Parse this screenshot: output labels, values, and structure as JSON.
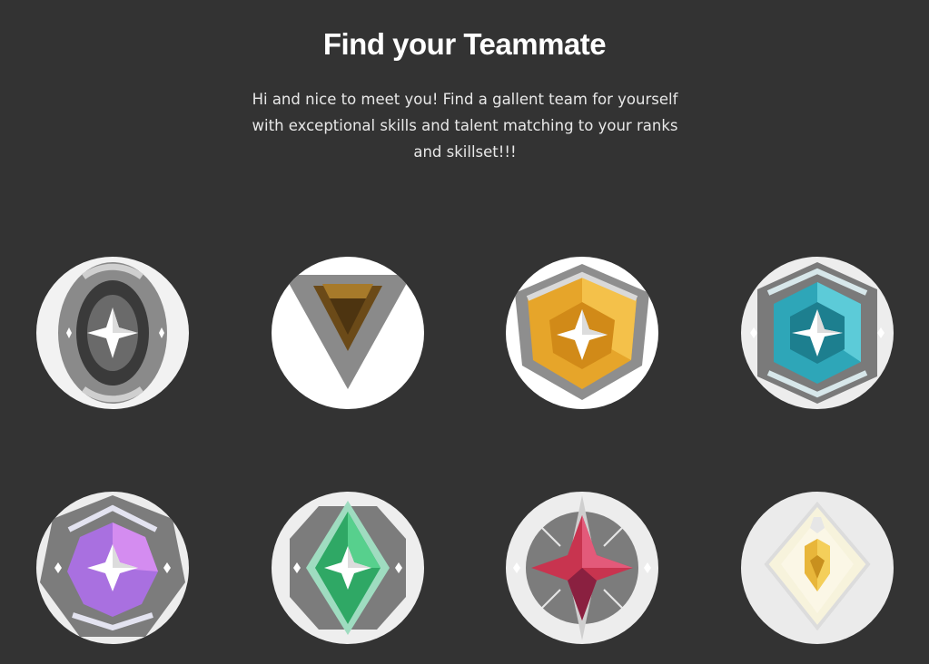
{
  "header": {
    "title": "Find your Teammate",
    "subtitle": "Hi and nice to meet you! Find a gallent team for yourself with exceptional skills and talent matching to your ranks and skillset!!!"
  },
  "ranks": [
    {
      "icon": "iron-rank-icon",
      "accent": "#5a5a5a"
    },
    {
      "icon": "bronze-rank-icon",
      "accent": "#8a5a1c"
    },
    {
      "icon": "gold-rank-icon",
      "accent": "#e6a52a"
    },
    {
      "icon": "platinum-rank-icon",
      "accent": "#2ea6b8"
    },
    {
      "icon": "diamond-rank-icon",
      "accent": "#c57ae8"
    },
    {
      "icon": "ascendant-rank-icon",
      "accent": "#2fa865"
    },
    {
      "icon": "immortal-rank-icon",
      "accent": "#c8344f"
    },
    {
      "icon": "radiant-rank-icon",
      "accent": "#e8b63a"
    }
  ]
}
